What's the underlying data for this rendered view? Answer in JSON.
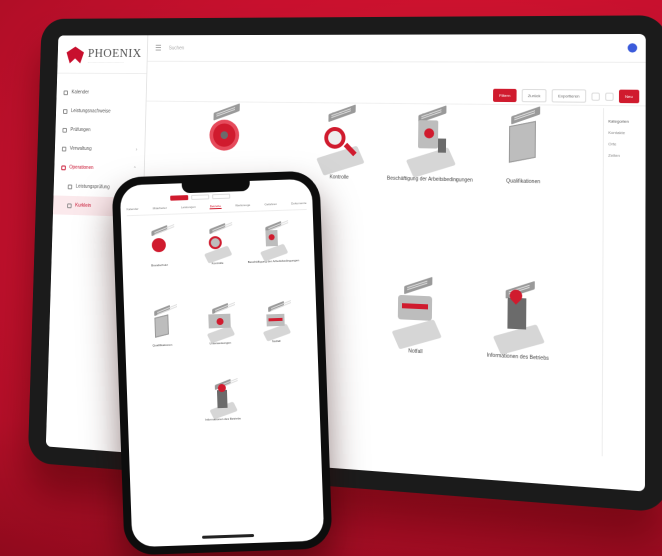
{
  "brand": {
    "name": "PHOENIX",
    "tagline": "·········································",
    "accent": "#c8102e"
  },
  "sidebar": {
    "items": [
      {
        "label": "Kalender",
        "icon": "calendar-icon"
      },
      {
        "label": "Leistungsnachweise",
        "icon": "document-icon"
      },
      {
        "label": "Prüfungen",
        "icon": "check-icon"
      },
      {
        "label": "Verwaltung",
        "icon": "folder-icon"
      },
      {
        "label": "Operationen",
        "icon": "list-icon"
      },
      {
        "label": "Leistungsprüfung",
        "icon": "pin-icon"
      },
      {
        "label": "Kurklein",
        "icon": "user-icon"
      }
    ]
  },
  "topbar": {
    "search_placeholder": "Suchen"
  },
  "toolbar": {
    "buttons": [
      "Filtern",
      "Zurück",
      "Exportieren",
      "Neu"
    ]
  },
  "rpanel": {
    "title": "Kategorien",
    "items": [
      "Kontakte",
      "Orte",
      "Zeiten"
    ]
  },
  "tiles": [
    {
      "label": ""
    },
    {
      "label": "Kontrolle"
    },
    {
      "label": "Beschäftigung der Arbeitsbedingungen"
    },
    {
      "label": "Qualifikationen"
    },
    {
      "label": "Notfall"
    },
    {
      "label": "Informationen des Betriebs"
    }
  ],
  "phone": {
    "tabs": [
      "Kalender",
      "Mitarbeiter",
      "Leistungen",
      "Betriebe",
      "Werkzeuge",
      "Gefahren",
      "Dokumente"
    ],
    "tiles": [
      {
        "label": "Brandschutz"
      },
      {
        "label": "Kontrolle"
      },
      {
        "label": "Beschäftigung der Arbeitsbedingungen"
      },
      {
        "label": "Qualifikationen"
      },
      {
        "label": "Unterweisungen"
      },
      {
        "label": "Notfall"
      },
      {
        "label": "Informationen des Betriebs"
      }
    ]
  }
}
